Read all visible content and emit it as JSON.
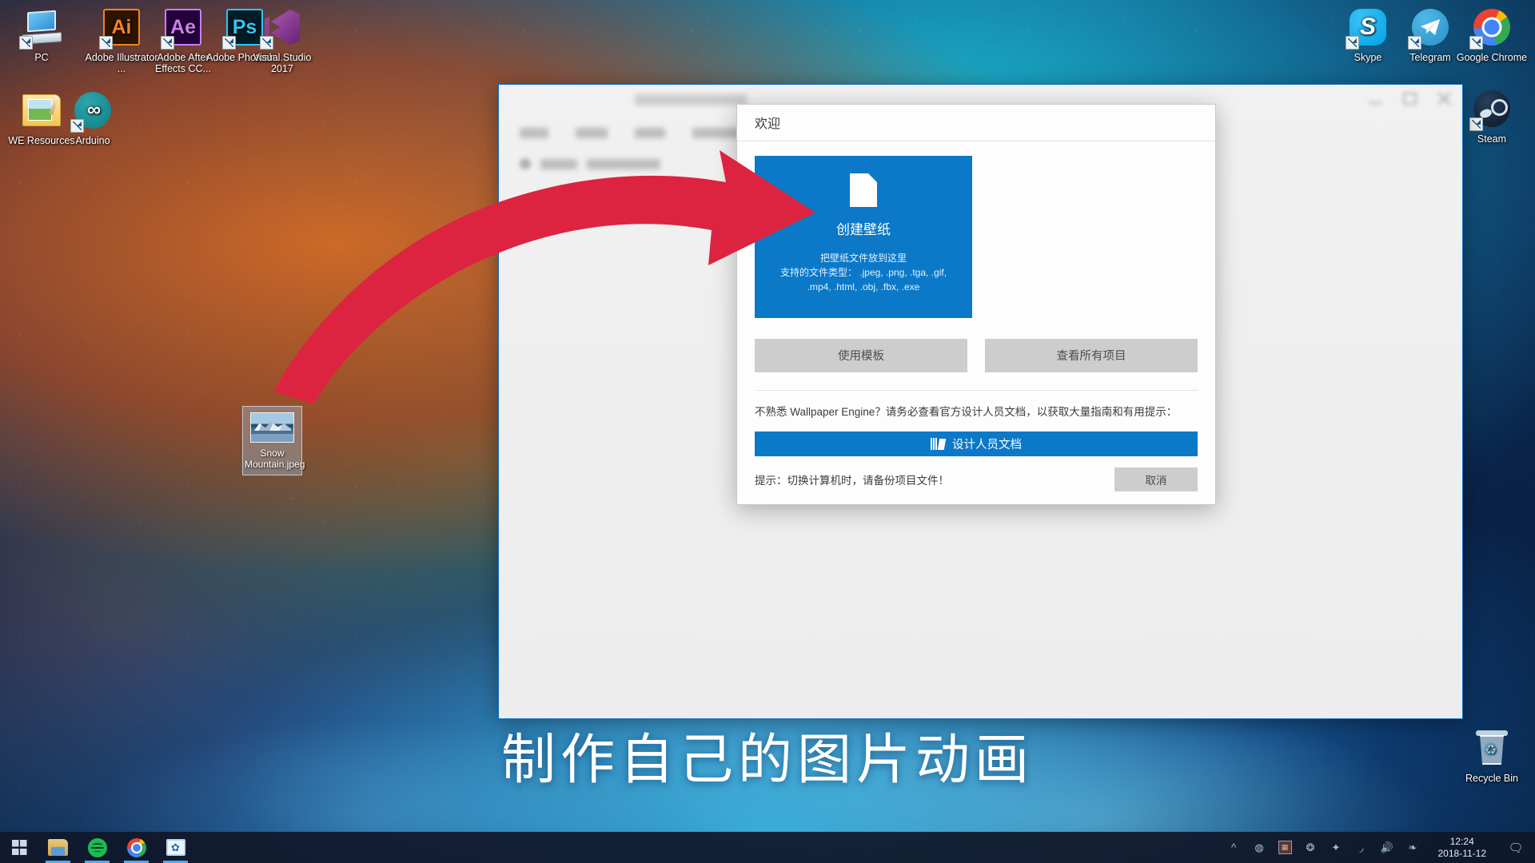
{
  "desktop": {
    "icons_left": [
      {
        "label": "PC",
        "icon": "pc-icon",
        "shortcut": true
      },
      {
        "label": "Adobe Illustrator ...",
        "icon": "adobe-illustrator-icon",
        "shortcut": true
      },
      {
        "label": "Adobe After Effects CC...",
        "icon": "adobe-after-effects-icon",
        "shortcut": true
      },
      {
        "label": "Adobe Photosh...",
        "icon": "adobe-photoshop-icon",
        "shortcut": true
      },
      {
        "label": "Visual Studio 2017",
        "icon": "visual-studio-icon",
        "shortcut": true
      },
      {
        "label": "WE Resources",
        "icon": "folder-icon",
        "shortcut": false
      },
      {
        "label": "Arduino",
        "icon": "arduino-icon",
        "shortcut": true
      }
    ],
    "icons_right": [
      {
        "label": "Skype",
        "icon": "skype-icon",
        "shortcut": true
      },
      {
        "label": "Telegram",
        "icon": "telegram-icon",
        "shortcut": true
      },
      {
        "label": "Google Chrome",
        "icon": "chrome-icon",
        "shortcut": true
      },
      {
        "label": "Steam",
        "icon": "steam-icon",
        "shortcut": true
      },
      {
        "label": "Recycle Bin",
        "icon": "recycle-bin-icon",
        "shortcut": false
      }
    ],
    "selected_file": {
      "label": "Snow Mountain.jpeg"
    },
    "caption": "制作自己的图片动画"
  },
  "app_window": {
    "title_blurred": true
  },
  "dialog": {
    "header_title": "欢迎",
    "create_panel": {
      "title": "创建壁纸",
      "drop_hint": "把壁纸文件放到这里",
      "types_line1": "支持的文件类型： .jpeg, .png, .tga, .gif,",
      "types_line2": ".mp4, .html, .obj, .fbx, .exe",
      "icon": "document-icon",
      "color": "#0b79c8"
    },
    "buttons": {
      "use_template": "使用模板",
      "view_all_projects": "查看所有项目",
      "cancel": "取消"
    },
    "docs": {
      "hint": "不熟悉 Wallpaper Engine？请务必查看官方设计人员文档，以获取大量指南和有用提示：",
      "button_label": "设计人员文档",
      "button_icon": "book-icon",
      "button_color": "#0b79c8"
    },
    "footer_tip": "提示：切换计算机时，请备份项目文件！",
    "gray_button_color": "#cdcdcd"
  },
  "annotation": {
    "arrow_color": "#dc2440",
    "arrow_name": "red-drag-arrow"
  },
  "taskbar": {
    "start": "start-button",
    "pinned": [
      {
        "name": "file-explorer",
        "running": true
      },
      {
        "name": "spotify",
        "running": true
      },
      {
        "name": "google-chrome",
        "running": true
      },
      {
        "name": "wallpaper-engine",
        "running": true
      }
    ],
    "tray_icons": [
      "chevron-up-icon",
      "steam-tray-icon",
      "screen-tray-icon",
      "wallpaper-engine-tray-icon",
      "dropbox-tray-icon",
      "wifi-icon",
      "volume-icon",
      "bluetooth-icon"
    ],
    "clock_time": "12:24",
    "clock_date": "2018-11-12",
    "action_center": "action-center-icon"
  }
}
